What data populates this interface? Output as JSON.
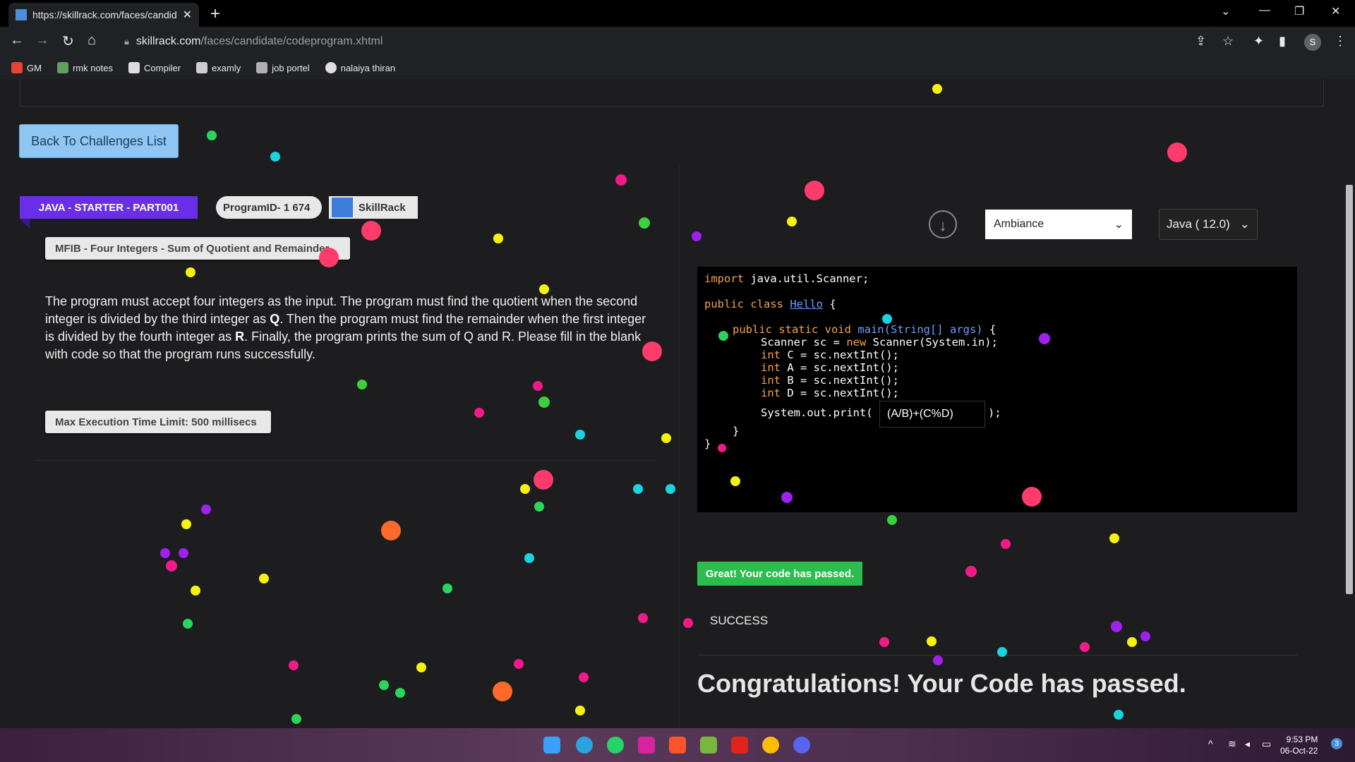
{
  "browser": {
    "tab_title": "https://skillrack.com/faces/candidate",
    "url_host": "skillrack.com",
    "url_path": "/faces/candidate/codeprogram.xhtml",
    "profile_initial": "S",
    "bookmarks": [
      {
        "label": "GM",
        "color": "#ea4335"
      },
      {
        "label": "rmk notes",
        "color": "#5f9f5f"
      },
      {
        "label": "Compiler",
        "color": "#dddddd"
      },
      {
        "label": "examly",
        "color": "#cfcfcf"
      },
      {
        "label": "job portel",
        "color": "#b0b0b0"
      },
      {
        "label": "nalaiya thiran",
        "color": "#e0e0e0"
      }
    ]
  },
  "nav": {
    "back_label": "Back To Challenges List"
  },
  "problem": {
    "track": "JAVA - STARTER - PART001",
    "program_id": "ProgramID- 1 674",
    "brand": "SkillRack",
    "title": "MFIB - Four Integers - Sum of Quotient and Remainder",
    "description_parts": {
      "p1": "The program must accept four integers as the input. The program must find the quotient when the second integer is divided by the third integer as ",
      "q": "Q",
      "p2": ". Then the program must find the remainder when the first integer is divided by the fourth integer as ",
      "r": "R",
      "p3": ". Finally, the program prints the sum of Q and R. Please fill in the blank with code so that the program runs successfully."
    },
    "time_limit": "Max Execution Time Limit: 500 millisecs"
  },
  "editor": {
    "theme": "Ambiance",
    "language": "Java ( 12.0)",
    "code": {
      "l1_kw": "import",
      "l1_rest": " java.util.Scanner;",
      "l2_kw": "public class",
      "l2_cls": "Hello",
      "l2_rest": " {",
      "l3_kw": "public static void",
      "l3_fn": " main",
      "l3_args": "(String[] args)",
      "l3_rest": " {",
      "l4": "Scanner sc = ",
      "l4_kw": "new",
      "l4_rest": " Scanner(System.in);",
      "int_kw": "int",
      "l5": " C = sc.nextInt();",
      "l6": " A = sc.nextInt();",
      "l7": " B = sc.nextInt();",
      "l8": " D = sc.nextInt();",
      "l9_pre": "System.out.print(",
      "l9_post": ");",
      "blank_value": "(A/B)+(C%D)",
      "close_inner": "}",
      "close_outer": "}"
    }
  },
  "result": {
    "badge": "Great! Your code has passed.",
    "status": "SUCCESS",
    "headline": "Congratulations! Your Code has passed."
  },
  "taskbar": {
    "time": "9:53 PM",
    "date": "06-Oct-22",
    "notifications": "3",
    "apps": [
      {
        "icon": "windows-icon",
        "color": "#3aa0ff"
      },
      {
        "icon": "telegram-icon",
        "color": "#2aa3e0"
      },
      {
        "icon": "whatsapp-icon",
        "color": "#25d366"
      },
      {
        "icon": "instagram-icon",
        "color": "#d6249f"
      },
      {
        "icon": "brave-icon",
        "color": "#fb542b"
      },
      {
        "icon": "utorrent-icon",
        "color": "#76b83f"
      },
      {
        "icon": "acrobat-icon",
        "color": "#e2231a"
      },
      {
        "icon": "chrome-icon",
        "color": "#fbbc05"
      },
      {
        "icon": "discord-icon",
        "color": "#5865f2"
      }
    ]
  }
}
